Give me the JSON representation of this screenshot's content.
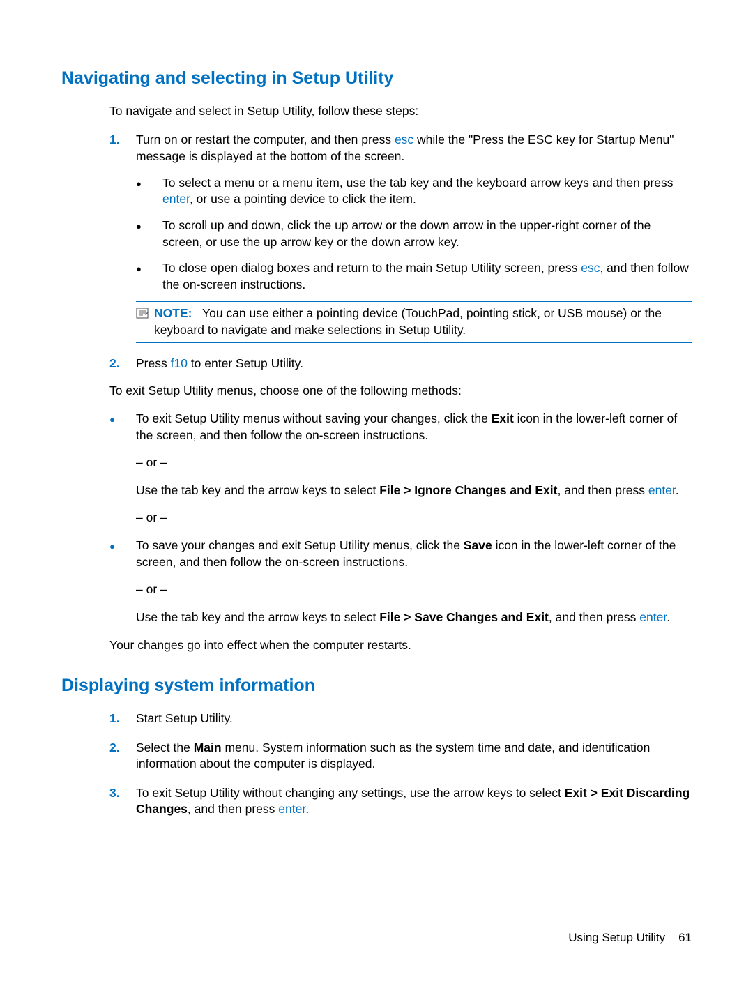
{
  "h1": "Navigating and selecting in Setup Utility",
  "intro": "To navigate and select in Setup Utility, follow these steps:",
  "step1num": "1.",
  "step1a": "Turn on or restart the computer, and then press ",
  "esc": "esc",
  "step1b": " while the \"Press the ESC key for Startup Menu\" message is displayed at the bottom of the screen.",
  "s1_b1a": "To select a menu or a menu item, use the tab key and the keyboard arrow keys and then press ",
  "enter": "enter",
  "s1_b1b": ", or use a pointing device to click the item.",
  "s1_b2": "To scroll up and down, click the up arrow or the down arrow in the upper-right corner of the screen, or use the up arrow key or the down arrow key.",
  "s1_b3a": "To close open dialog boxes and return to the main Setup Utility screen, press ",
  "s1_b3b": ", and then follow the on-screen instructions.",
  "note_label": "NOTE:",
  "note_body": "You can use either a pointing device (TouchPad, pointing stick, or USB mouse) or the keyboard to navigate and make selections in Setup Utility.",
  "step2num": "2.",
  "step2a": "Press ",
  "f10": "f10",
  "step2b": " to enter Setup Utility.",
  "exit_intro": "To exit Setup Utility menus, choose one of the following methods:",
  "exit_b1a": "To exit Setup Utility menus without saving your changes, click the ",
  "exit_b1_bold": "Exit",
  "exit_b1b": " icon in the lower-left corner of the screen, and then follow the on-screen instructions.",
  "or": "– or –",
  "exit_b1c": "Use the tab key and the arrow keys to select ",
  "exit_b1_bold2": "File > Ignore Changes and Exit",
  "exit_b1d": ", and then press ",
  "period": ".",
  "exit_b2a": "To save your changes and exit Setup Utility menus, click the ",
  "exit_b2_bold": "Save",
  "exit_b2b": " icon in the lower-left corner of the screen, and then follow the on-screen instructions.",
  "exit_b2c": "Use the tab key and the arrow keys to select ",
  "exit_b2_bold2": "File > Save Changes and Exit",
  "exit_b2d": ", and then press ",
  "exit_outro": "Your changes go into effect when the computer restarts.",
  "h2": "Displaying system information",
  "d_step1num": "1.",
  "d_step1": "Start Setup Utility.",
  "d_step2num": "2.",
  "d_step2a": "Select the ",
  "d_step2_bold": "Main",
  "d_step2b": " menu. System information such as the system time and date, and identification information about the computer is displayed.",
  "d_step3num": "3.",
  "d_step3a": "To exit Setup Utility without changing any settings, use the arrow keys to select ",
  "d_step3_bold": "Exit > Exit Discarding Changes",
  "d_step3b": ", and then press ",
  "footer_text": "Using Setup Utility",
  "footer_page": "61"
}
